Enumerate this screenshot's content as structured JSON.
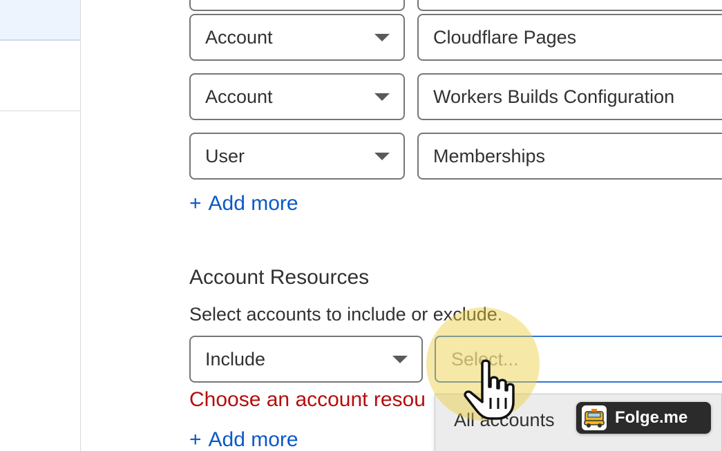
{
  "permissions": {
    "rows": [
      {
        "scope": "Account",
        "permission": "Cloudflare Pages"
      },
      {
        "scope": "Account",
        "permission": "Workers Builds Configuration"
      },
      {
        "scope": "User",
        "permission": "Memberships"
      }
    ],
    "add_more": "Add more"
  },
  "account_resources": {
    "title": "Account Resources",
    "description": "Select accounts to include or exclude.",
    "mode": "Include",
    "select_placeholder": "Select...",
    "error": "Choose an account resou",
    "add_more": "Add more",
    "dropdown_option": "All accounts"
  },
  "watermark": {
    "text": "Folge.me"
  },
  "colors": {
    "link": "#0a58ca",
    "error": "#b50d0d",
    "focus": "#2f74d8",
    "highlight": "#eccc3c"
  }
}
